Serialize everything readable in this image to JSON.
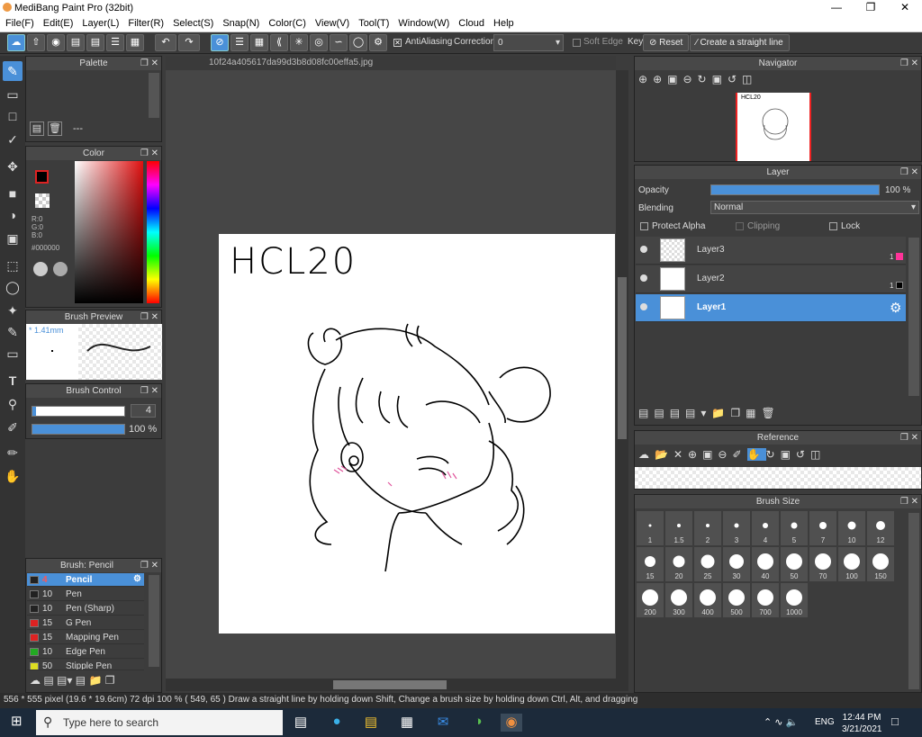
{
  "app": {
    "title": "MediBang Paint Pro (32bit)"
  },
  "menu": [
    "File(F)",
    "Edit(E)",
    "Layer(L)",
    "Filter(R)",
    "Select(S)",
    "Snap(N)",
    "Color(C)",
    "View(V)",
    "Tool(T)",
    "Window(W)",
    "Cloud",
    "Help"
  ],
  "toolbar": {
    "antialiasing": "AntiAliasing",
    "correction_label": "Correction",
    "correction_value": "0",
    "soft_edge": "Soft Edge",
    "key_label": "Key",
    "reset_label": "Reset",
    "straight_line_label": "Create a straight line"
  },
  "document": {
    "tab_name": "10f24a405617da99d3b8d08fc00effa5.jpg",
    "sketch_text": "HCL20"
  },
  "panels": {
    "palette": "Palette",
    "palette_dash": "---",
    "color": "Color",
    "rgb": {
      "r": "R:0",
      "g": "G:0",
      "b": "B:0",
      "hex": "#000000"
    },
    "brush_preview": "Brush Preview",
    "brush_preview_size": "* 1.41mm",
    "brush_control": "Brush Control",
    "brush_control_size": "4",
    "brush_control_opacity": "100 %",
    "brush_list_title": "Brush: Pencil",
    "navigator": "Navigator",
    "layer": "Layer",
    "reference": "Reference",
    "brush_size": "Brush Size"
  },
  "brushes": [
    {
      "size": "4",
      "name": "Pencil",
      "color": "#222222"
    },
    {
      "size": "10",
      "name": "Pen",
      "color": "#222222"
    },
    {
      "size": "10",
      "name": "Pen (Sharp)",
      "color": "#222222"
    },
    {
      "size": "15",
      "name": "G Pen",
      "color": "#dd2222"
    },
    {
      "size": "15",
      "name": "Mapping Pen",
      "color": "#dd2222"
    },
    {
      "size": "10",
      "name": "Edge Pen",
      "color": "#22aa22"
    },
    {
      "size": "50",
      "name": "Stipple Pen",
      "color": "#dddd22"
    }
  ],
  "layer_panel": {
    "opacity_label": "Opacity",
    "opacity_value": "100 %",
    "blending_label": "Blending",
    "blending_value": "Normal",
    "protect_alpha": "Protect Alpha",
    "clipping": "Clipping",
    "lock": "Lock",
    "layers": [
      {
        "name": "Layer3",
        "num": "1",
        "swatch": "#ff3399"
      },
      {
        "name": "Layer2",
        "num": "1",
        "swatch": "#000000"
      },
      {
        "name": "Layer1",
        "num": "",
        "swatch": ""
      }
    ]
  },
  "brush_sizes": [
    "1",
    "1.5",
    "2",
    "3",
    "4",
    "5",
    "7",
    "10",
    "12",
    "15",
    "20",
    "25",
    "30",
    "40",
    "50",
    "70",
    "100",
    "150",
    "200",
    "300",
    "400",
    "500",
    "700",
    "1000"
  ],
  "status": {
    "text": "556 * 555 pixel   (19.6 * 19.6cm)   72 dpi   100 %   ( 549, 65 )   Draw a straight line by holding down Shift, Change a brush size by holding down Ctrl, Alt, and dragging"
  },
  "taskbar": {
    "search_placeholder": "Type here to search",
    "lang": "ENG",
    "time": "12:44 PM",
    "date": "3/21/2021"
  }
}
